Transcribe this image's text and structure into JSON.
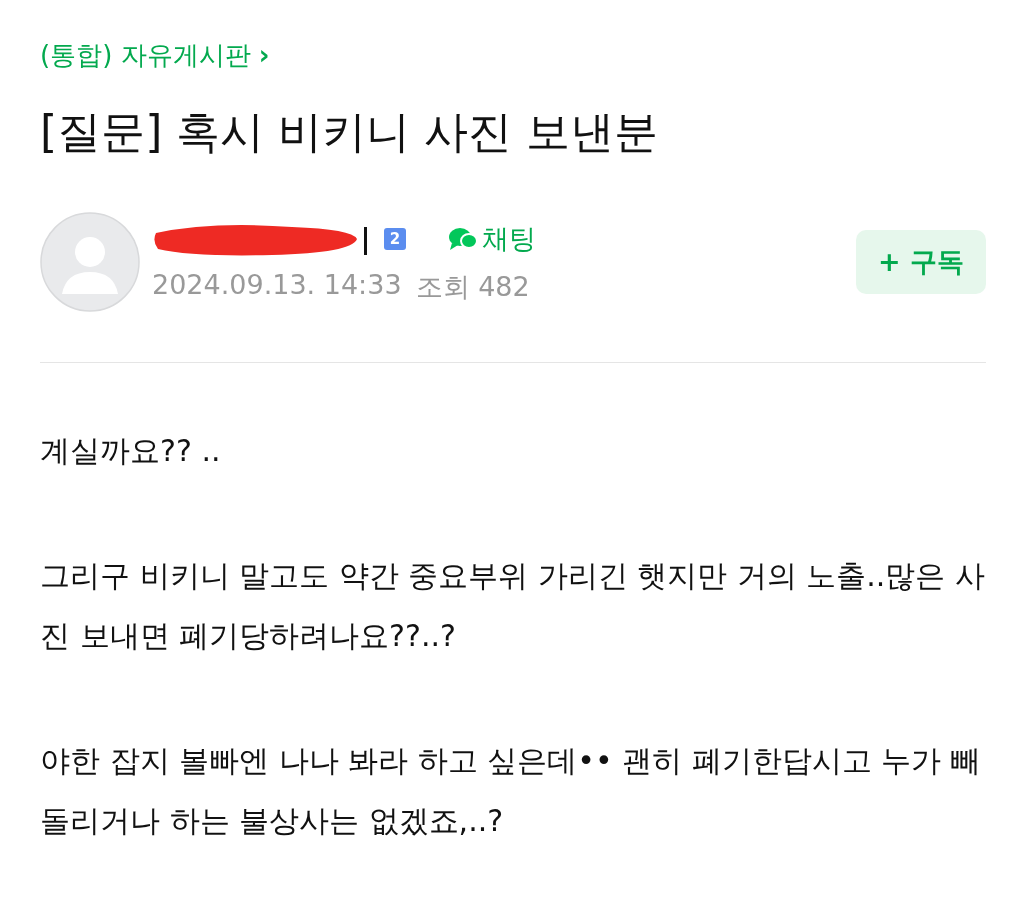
{
  "breadcrumb": {
    "label": "(통합) 자유게시판",
    "arrow": "›"
  },
  "title": "[질문] 혹시 비키니 사진 보낸분",
  "author": {
    "level_badge": "2",
    "chat_label": "채팅",
    "date": "2024.09.13. 14:33",
    "views": "조회 482"
  },
  "subscribe_button": {
    "label": "+ 구독"
  },
  "paragraphs": [
    "계실까요?? ..",
    "그리구 비키니 말고도 약간 중요부위 가리긴 햇지만 거의 노출..많은 사진 보내면 폐기당하려나요??..?",
    "야한 잡지 볼빠엔 나나 봐라 하고 싶은데•• 괜히 폐기한답시고 누가 빼돌리거나 하는 불상사는 없겠죠,..?"
  ]
}
